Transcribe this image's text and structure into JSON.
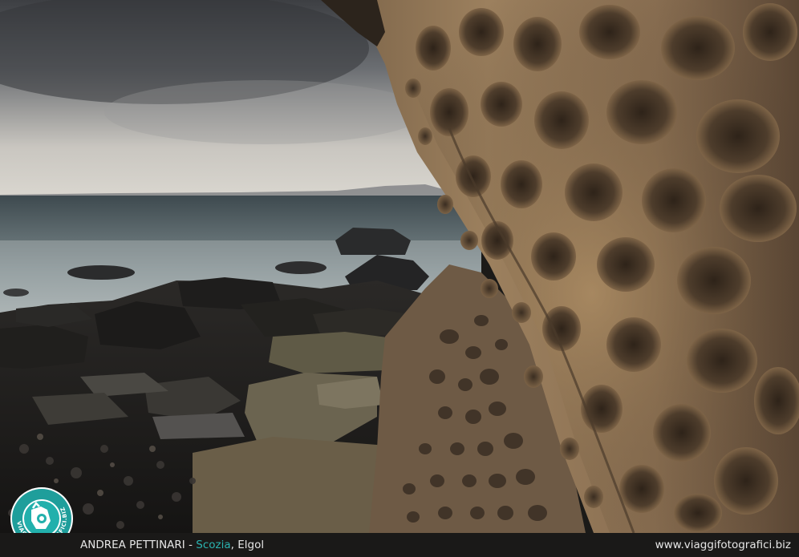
{
  "caption": {
    "author": "ANDREA PETTINARI",
    "separator": " - ",
    "country": "Scozia",
    "comma": ", ",
    "place": "Elgol",
    "website": "www.viaggifotografici.biz"
  },
  "logo": {
    "ring_text": "VIAGGIFOTOGRAFICI.BIZ"
  },
  "colors": {
    "accent": "#2ab3b0",
    "bar": "#1a1918"
  }
}
